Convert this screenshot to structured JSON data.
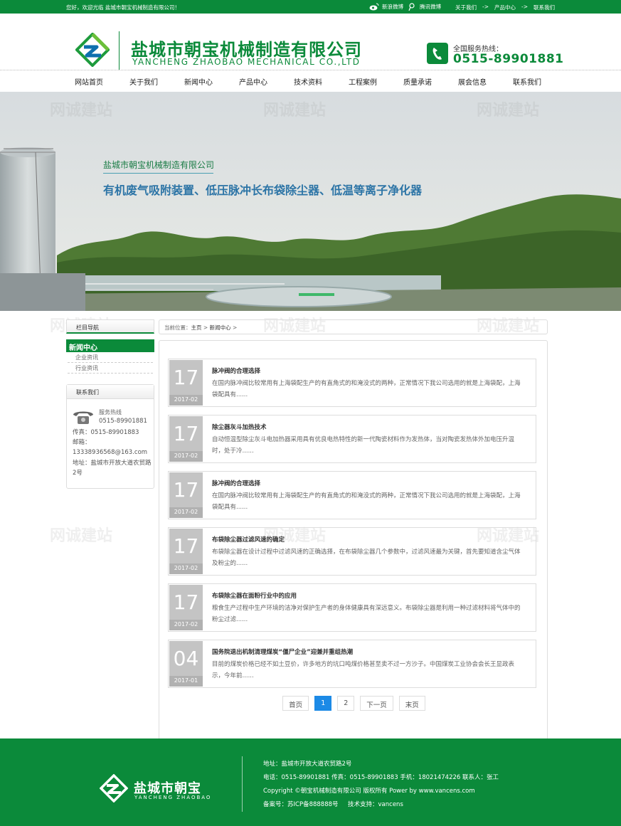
{
  "topbar": {
    "welcome": "您好，欢迎光临 盐城市朝宝机械制造有限公司！",
    "weibo_sina": "新浪微博",
    "weibo_tencent": "腾讯微博",
    "links": [
      "关于我们",
      "->",
      "产品中心",
      "->",
      "联系我们"
    ]
  },
  "header": {
    "company_cn": "盐城市朝宝机械制造有限公司",
    "company_en": "YANCHENG ZHAOBAO MECHANICAL CO.,LTD",
    "hotline_label": "全国服务热线：",
    "hotline_number": "0515-89901881"
  },
  "nav": [
    "网站首页",
    "关于我们",
    "新闻中心",
    "产品中心",
    "技术资料",
    "工程案例",
    "质量承诺",
    "展会信息",
    "联系我们"
  ],
  "banner": {
    "subtitle": "盐城市朝宝机械制造有限公司",
    "slogan": "有机废气吸附装置、低压脉冲长布袋除尘器、低温等离子净化器"
  },
  "watermark": "网诚建站",
  "sidebar": {
    "nav_heading": "栏目导航",
    "active": "新闻中心",
    "items": [
      "企业资讯",
      "行业资讯"
    ],
    "contact_heading": "联系我们",
    "service_label": "服务热线",
    "service_number": "0515-89901881",
    "fax": "传真：0515-89901883",
    "email_label": "邮箱：",
    "email": "13338936568@163.com",
    "address": "地址：盐城市开放大道农贸路2号"
  },
  "breadcrumb": {
    "prefix": "当前位置：",
    "home": "主页",
    "sep1": ">",
    "current": "新闻中心",
    "sep2": ">"
  },
  "news": [
    {
      "day": "17",
      "ym": "2017-02",
      "title": "脉冲阀的合理选择",
      "summary": "在国内脉冲阀比较常用有上海袋配生产的有直角式的和淹没式的两种，正常情况下我公司选用的就是上海袋配，上海袋配具有......"
    },
    {
      "day": "17",
      "ym": "2017-02",
      "title": "除尘器灰斗加热技术",
      "summary": "自动恒温型除尘灰斗电加热器采用具有优良电热特性的新一代陶瓷材料作为发热体，当对陶瓷发热体外加电压升温时，处于冷......"
    },
    {
      "day": "17",
      "ym": "2017-02",
      "title": "脉冲阀的合理选择",
      "summary": "在国内脉冲阀比较常用有上海袋配生产的有直角式的和淹没式的两种，正常情况下我公司选用的就是上海袋配，上海袋配具有......"
    },
    {
      "day": "17",
      "ym": "2017-02",
      "title": "布袋除尘器过滤风速的确定",
      "summary": "布袋除尘器在设计过程中过滤风速的正确选择，在布袋除尘器几个参数中，过滤风速最为关键，首先要知道含尘气体及粉尘的......"
    },
    {
      "day": "17",
      "ym": "2017-02",
      "title": "布袋除尘器在面粉行业中的应用",
      "summary": "粮食生产过程中生产环境的洁净对保护生产者的身体健康具有深远意义。布袋除尘器是利用一种过滤材料将气体中的粉尘过滤......"
    },
    {
      "day": "04",
      "ym": "2017-01",
      "title": "国务院退出机制清理煤炭“僵尸企业”迎兼并重组热潮",
      "summary": "目前的煤炭价格已经不如土豆价，许多地方的坑口吨煤价格甚至卖不过一方沙子。中国煤炭工业协会会长王显政表示，今年前......"
    }
  ],
  "pager": {
    "first": "首页",
    "pages": [
      "1",
      "2"
    ],
    "next": "下一页",
    "last": "末页",
    "current": "1"
  },
  "footer": {
    "name": "盐城市朝宝",
    "name_en": "YANCHENG ZHAOBAO",
    "address": "地址：盐城市开放大道农贸路2号",
    "contacts": "电话：0515-89901881 传真：0515-89901883 手机：18021474226 联系人：张工",
    "copyright": "Copyright ©朝宝机械制造有限公司 版权所有 Power by www.vancens.com",
    "icp": "备案号：苏ICP备888888号     技术支持：vancens"
  },
  "colors": {
    "brand_green": "#0b8a3a",
    "pager_active": "#1c8ae6",
    "slogan_blue": "#2c74a6"
  }
}
